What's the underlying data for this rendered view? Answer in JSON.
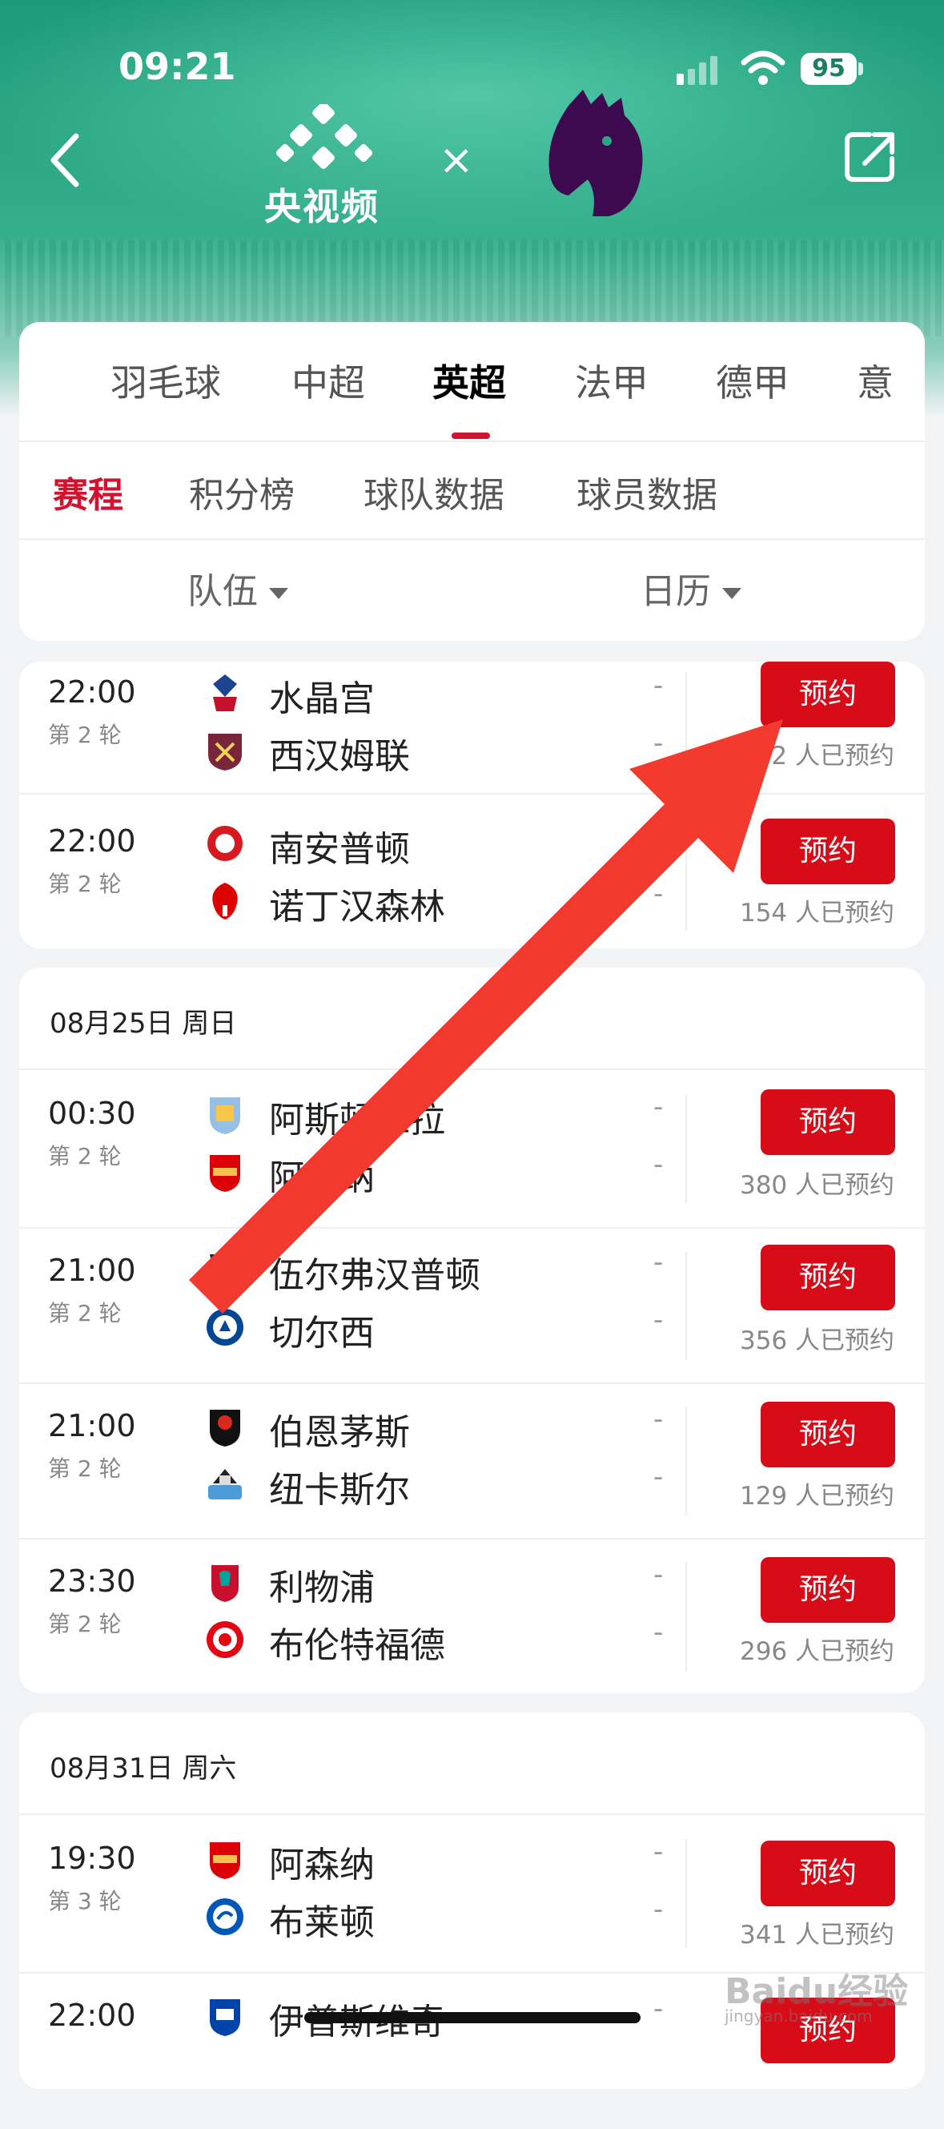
{
  "status": {
    "time": "09:21",
    "battery": "95"
  },
  "header": {
    "brand": "央视频",
    "times": "×"
  },
  "tabs": [
    {
      "label": "羽毛球"
    },
    {
      "label": "中超"
    },
    {
      "label": "英超"
    },
    {
      "label": "法甲"
    },
    {
      "label": "德甲"
    },
    {
      "label": "意"
    }
  ],
  "subtabs": [
    {
      "label": "赛程"
    },
    {
      "label": "积分榜"
    },
    {
      "label": "球队数据"
    },
    {
      "label": "球员数据"
    }
  ],
  "filters": {
    "team": "队伍",
    "calendar": "日历"
  },
  "group1": {
    "matches": [
      {
        "time": "22:00",
        "round": "第 2 轮",
        "home": "水晶宫",
        "away": "西汉姆联",
        "hs": "-",
        "as": "-",
        "btn": "预约",
        "count": "2 人已预约"
      },
      {
        "time": "22:00",
        "round": "第 2 轮",
        "home": "南安普顿",
        "away": "诺丁汉森林",
        "hs": "-",
        "as": "-",
        "btn": "预约",
        "count": "154 人已预约"
      }
    ]
  },
  "group2": {
    "date": "08月25日 周日",
    "matches": [
      {
        "time": "00:30",
        "round": "第 2 轮",
        "home": "阿斯顿维拉",
        "away": "阿森纳",
        "hs": "-",
        "as": "-",
        "btn": "预约",
        "count": "380 人已预约"
      },
      {
        "time": "21:00",
        "round": "第 2 轮",
        "home": "伍尔弗汉普顿",
        "away": "切尔西",
        "hs": "-",
        "as": "-",
        "btn": "预约",
        "count": "356 人已预约"
      },
      {
        "time": "21:00",
        "round": "第 2 轮",
        "home": "伯恩茅斯",
        "away": "纽卡斯尔",
        "hs": "-",
        "as": "-",
        "btn": "预约",
        "count": "129 人已预约"
      },
      {
        "time": "23:30",
        "round": "第 2 轮",
        "home": "利物浦",
        "away": "布伦特福德",
        "hs": "-",
        "as": "-",
        "btn": "预约",
        "count": "296 人已预约"
      }
    ]
  },
  "group3": {
    "date": "08月31日 周六",
    "matches": [
      {
        "time": "19:30",
        "round": "第 3 轮",
        "home": "阿森纳",
        "away": "布莱顿",
        "hs": "-",
        "as": "-",
        "btn": "预约",
        "count": "341 人已预约"
      },
      {
        "time": "22:00",
        "round": "",
        "home": "伊普斯维奇",
        "away": "",
        "hs": "-",
        "as": "",
        "btn": "预约",
        "count": ""
      }
    ]
  },
  "colors": {
    "accent": "#d80c18",
    "brand_green": "#2aa683",
    "pl_purple": "#3d0a4f"
  },
  "watermark": {
    "text": "Baidu经验",
    "url": "jingyan.baidu.com"
  }
}
